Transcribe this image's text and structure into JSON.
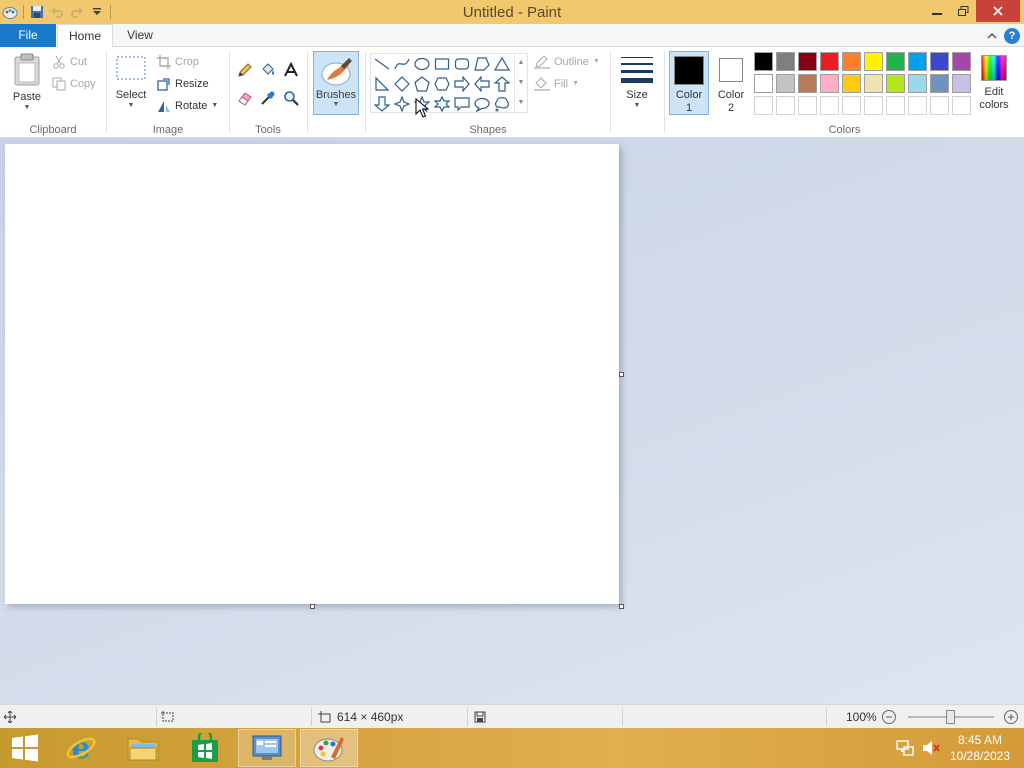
{
  "window": {
    "title": "Untitled - Paint"
  },
  "tabs": {
    "file": "File",
    "home": "Home",
    "view": "View"
  },
  "clipboard": {
    "group_label": "Clipboard",
    "paste": "Paste",
    "cut": "Cut",
    "copy": "Copy"
  },
  "image": {
    "group_label": "Image",
    "select": "Select",
    "crop": "Crop",
    "resize": "Resize",
    "rotate": "Rotate"
  },
  "tools": {
    "group_label": "Tools"
  },
  "brushes": {
    "label": "Brushes"
  },
  "shapes": {
    "group_label": "Shapes",
    "outline": "Outline",
    "fill": "Fill"
  },
  "size": {
    "label": "Size"
  },
  "colors": {
    "group_label": "Colors",
    "color1_label": "Color",
    "color1_num": "1",
    "color2_label": "Color",
    "color2_num": "2",
    "color1_value": "#000000",
    "color2_value": "#ffffff",
    "edit_label": "Edit",
    "edit_label2": "colors",
    "palette_row1": [
      "#000000",
      "#7f7f7f",
      "#880015",
      "#ed1c24",
      "#ff7f27",
      "#fff200",
      "#22b14c",
      "#00a2e8",
      "#3f48cc",
      "#a349a4"
    ],
    "palette_row2": [
      "#ffffff",
      "#c3c3c3",
      "#b97a57",
      "#ffaec9",
      "#ffc90e",
      "#efe4b0",
      "#b5e61d",
      "#99d9ea",
      "#7092be",
      "#c8bfe7"
    ]
  },
  "status": {
    "canvas_size": "614 × 460px",
    "zoom": "100%"
  },
  "taskbar": {
    "time": "8:45 AM",
    "date": "10/28/2023"
  }
}
